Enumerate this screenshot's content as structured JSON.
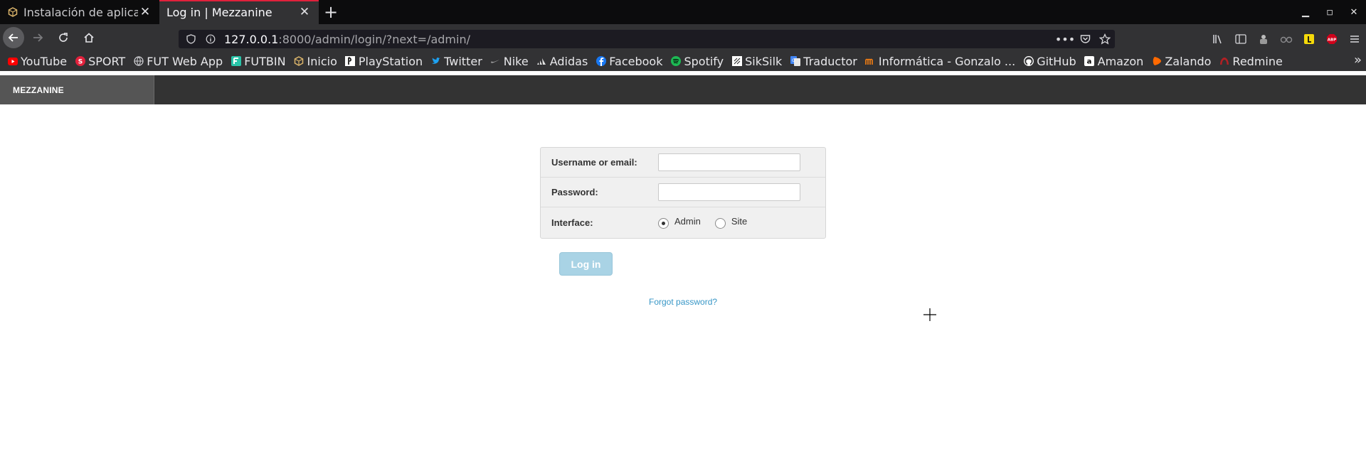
{
  "browser": {
    "tabs": [
      {
        "title": "Instalación de aplicaci",
        "active": false,
        "icon": "box-icon"
      },
      {
        "title": "Log in | Mezzanine",
        "active": true,
        "icon": "none"
      }
    ],
    "new_tab_label": "+",
    "url": {
      "host": "127.0.0.1",
      "rest": ":8000/admin/login/?next=/admin/"
    },
    "bookmarks": [
      {
        "label": "YouTube",
        "icon": "youtube-icon",
        "color": "#ff0000"
      },
      {
        "label": "SPORT",
        "icon": "sport-icon",
        "color": "#e1213c"
      },
      {
        "label": "FUT Web App",
        "icon": "globe-icon",
        "color": "#d7d7db"
      },
      {
        "label": "FUTBIN",
        "icon": "futbin-icon",
        "color": "#29c4a9"
      },
      {
        "label": "Inicio",
        "icon": "box-icon",
        "color": "#d9b36a"
      },
      {
        "label": "PlayStation",
        "icon": "playstation-icon",
        "color": "#ffffff"
      },
      {
        "label": "Twitter",
        "icon": "twitter-icon",
        "color": "#1da1f2"
      },
      {
        "label": "Nike",
        "icon": "nike-icon",
        "color": "#9a9a9a"
      },
      {
        "label": "Adidas",
        "icon": "adidas-icon",
        "color": "#e0e0e0"
      },
      {
        "label": "Facebook",
        "icon": "facebook-icon",
        "color": "#1877f2"
      },
      {
        "label": "Spotify",
        "icon": "spotify-icon",
        "color": "#1db954"
      },
      {
        "label": "SikSilk",
        "icon": "siksilk-icon",
        "color": "#ffffff"
      },
      {
        "label": "Traductor",
        "icon": "translate-icon",
        "color": "#4285f4"
      },
      {
        "label": "Informática - Gonzalo ...",
        "icon": "moodle-icon",
        "color": "#f98012"
      },
      {
        "label": "GitHub",
        "icon": "github-icon",
        "color": "#ffffff"
      },
      {
        "label": "Amazon",
        "icon": "amazon-icon",
        "color": "#ffffff"
      },
      {
        "label": "Zalando",
        "icon": "zalando-icon",
        "color": "#ff6900"
      },
      {
        "label": "Redmine",
        "icon": "redmine-icon",
        "color": "#b32024"
      }
    ]
  },
  "page": {
    "brand": "MEZZANINE",
    "form": {
      "username_label": "Username or email:",
      "username_value": "",
      "password_label": "Password:",
      "password_value": "",
      "interface_label": "Interface:",
      "interface_options": [
        {
          "label": "Admin",
          "checked": true
        },
        {
          "label": "Site",
          "checked": false
        }
      ]
    },
    "login_button": "Log in",
    "forgot_link": "Forgot password?"
  }
}
